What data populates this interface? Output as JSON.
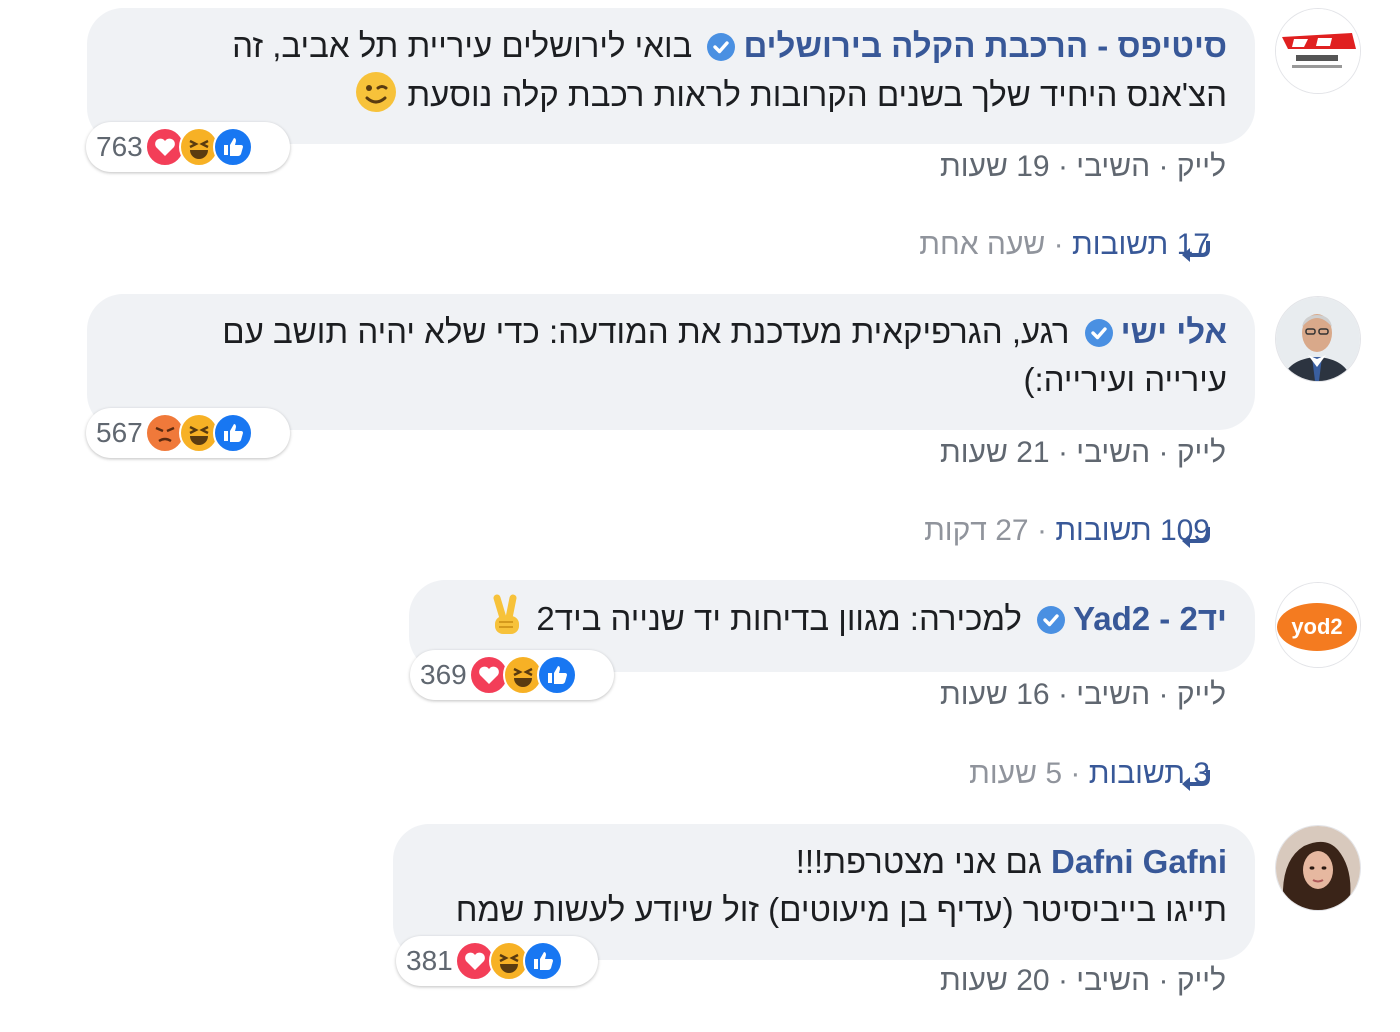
{
  "comments": [
    {
      "author": "סיטיפס - הרכבת הקלה בירושלים",
      "verified": true,
      "text_line1": "בואי לירושלים עיריית תל אביב, זה",
      "text_line2": "הצ'אנס היחיד שלך בשנים הקרובות לראות רכבת קלה נוסעת",
      "emoji": "winking-face",
      "reaction_count": "763",
      "reactions": [
        "like",
        "haha",
        "love"
      ],
      "like_label": "לייק",
      "reply_label": "השיבי",
      "sep": "·",
      "time": "19 שעות",
      "replies_count": "17 תשובות",
      "replies_time": "שעה אחת"
    },
    {
      "author": "אלי ישי",
      "verified": true,
      "text_line1": "רגע, הגרפיקאית מעדכנת את המודעה: כדי שלא יהיה תושב עם",
      "text_line2": "עירייה ועירייה:)",
      "reaction_count": "567",
      "reactions": [
        "like",
        "haha",
        "angry"
      ],
      "like_label": "לייק",
      "reply_label": "השיבי",
      "sep": "·",
      "time": "21 שעות",
      "replies_count": "109 תשובות",
      "replies_time": "27 דקות"
    },
    {
      "author": "יד2 - Yad2",
      "verified": true,
      "text_line1": "למכירה: מגוון בדיחות יד שנייה ביד2",
      "emoji": "victory-hand",
      "avatar_text": "yod2",
      "reaction_count": "369",
      "reactions": [
        "like",
        "haha",
        "love"
      ],
      "like_label": "לייק",
      "reply_label": "השיבי",
      "sep": "·",
      "time": "16 שעות",
      "replies_count": "3 תשובות",
      "replies_time": "5 שעות"
    },
    {
      "author": "Dafni Gafni",
      "verified": false,
      "text_line1": "גם אני מצטרפת!!!",
      "text_line2": "תייגו בייביסיטר (עדיף בן מיעוטים) זול שיודע לעשות שמח",
      "reaction_count": "381",
      "reactions": [
        "like",
        "haha",
        "love"
      ],
      "like_label": "לייק",
      "reply_label": "השיבי",
      "sep": "·",
      "time": "20 שעות"
    }
  ],
  "colors": {
    "author": "#385898",
    "bubble": "#f0f2f5",
    "meta": "#606770",
    "like": "#1877f2",
    "love": "#f33e58",
    "haha": "#f7b125"
  }
}
